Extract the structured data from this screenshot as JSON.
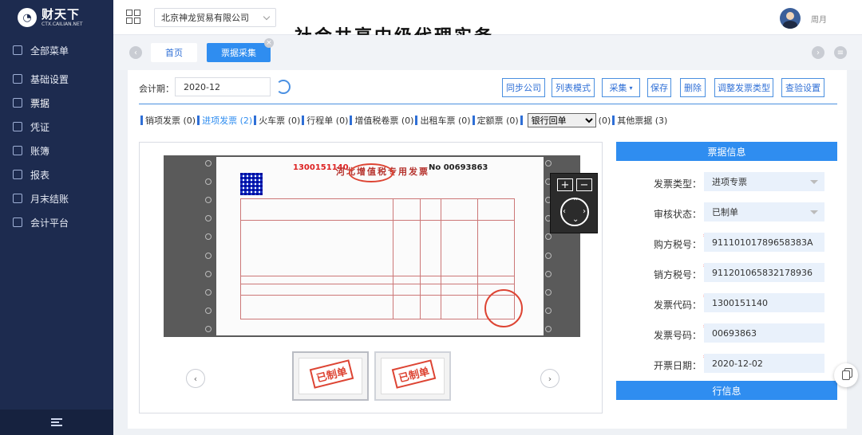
{
  "brand": {
    "name": "财天下",
    "sub": "CTX.CAILIAN.NET"
  },
  "sidebar": {
    "items": [
      {
        "label": "全部菜单"
      },
      {
        "label": "基础设置"
      },
      {
        "label": "票据"
      },
      {
        "label": "凭证"
      },
      {
        "label": "账簿"
      },
      {
        "label": "报表"
      },
      {
        "label": "月末结账"
      },
      {
        "label": "会计平台"
      }
    ]
  },
  "header": {
    "company": "北京神龙贸易有限公司",
    "user": "周月",
    "headline": "社会共享中级代理实务"
  },
  "tabs": [
    {
      "label": "首页"
    },
    {
      "label": "票据采集"
    }
  ],
  "toolbar": {
    "period_label": "会计期：",
    "period_value": "2020-12",
    "buttons": [
      "同步公司",
      "列表模式",
      "采集",
      "保存",
      "删除",
      "调整发票类型",
      "查验设置"
    ]
  },
  "types": [
    {
      "label": "销项发票",
      "count": "(0)"
    },
    {
      "label": "进项发票",
      "count": "(2)"
    },
    {
      "label": "火车票",
      "count": "(0)"
    },
    {
      "label": "行程单",
      "count": "(0)"
    },
    {
      "label": "增值税卷票",
      "count": "(0)"
    },
    {
      "label": "出租车票",
      "count": "(0)"
    },
    {
      "label": "定额票",
      "count": "(0)"
    },
    {
      "label": "银行回单",
      "count": "(0)"
    },
    {
      "label": "其他票据",
      "count": "(3)"
    }
  ],
  "invoice": {
    "title": "河北增值税专用发票",
    "code": "1300151140",
    "number": "No 00693863"
  },
  "thumbs": [
    {
      "stamp": "已制单"
    },
    {
      "stamp": "已制单"
    }
  ],
  "info": {
    "title": "票据信息",
    "fields": [
      {
        "label": "发票类型：",
        "value": "进项专票",
        "dropdown": true
      },
      {
        "label": "审核状态：",
        "value": "已制单",
        "dropdown": true
      },
      {
        "label": "购方税号：",
        "value": "91110101789658383A",
        "required": true
      },
      {
        "label": "销方税号：",
        "value": "911201065832178936",
        "required": true
      },
      {
        "label": "发票代码：",
        "value": "1300151140",
        "required": true
      },
      {
        "label": "发票号码：",
        "value": "00693863",
        "required": true
      },
      {
        "label": "开票日期：",
        "value": "2020-12-02",
        "required": true
      }
    ],
    "line_title": "行信息"
  },
  "colors": {
    "sidebar": "#1d2b4f",
    "accent": "#2f8df0"
  }
}
